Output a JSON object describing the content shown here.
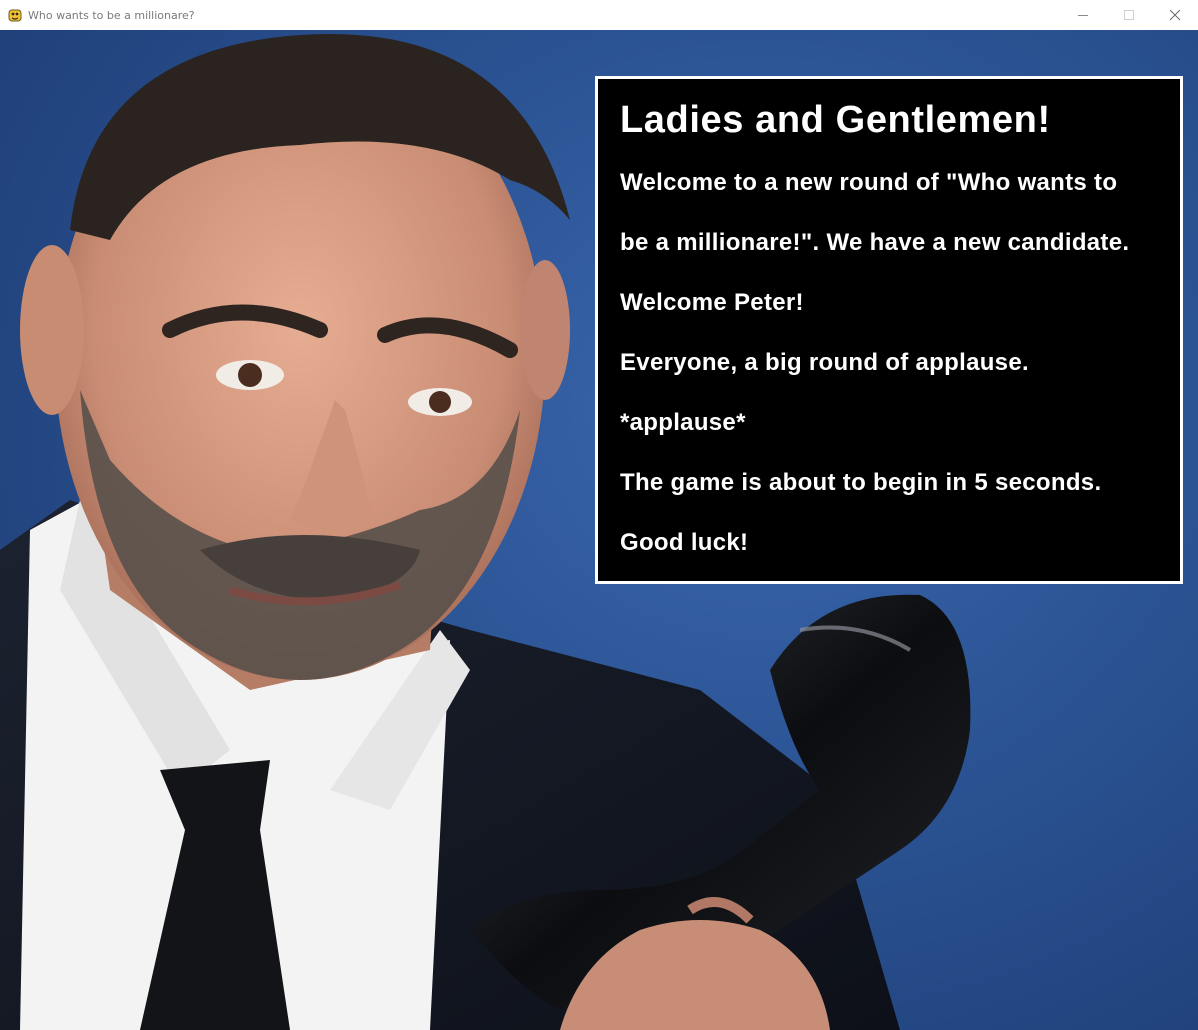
{
  "window": {
    "title": "Who wants to be a millionare?",
    "icon": "pygame-snake-icon",
    "controls": [
      "minimize-icon",
      "maximize-icon",
      "close-icon"
    ]
  },
  "scene": {
    "background_color": "#2c5596"
  },
  "dialog": {
    "heading": "Ladies and Gentlemen!",
    "lines": [
      "Welcome to a new round of \"Who wants to",
      "be a millionare!\". We have a new candidate.",
      "Welcome Peter!",
      "Everyone, a big round of applause.",
      "*applause*",
      "The game is about to begin in 5 seconds.",
      "Good luck!"
    ],
    "background": "#000000",
    "border_color": "#ffffff",
    "text_color": "#ffffff"
  }
}
